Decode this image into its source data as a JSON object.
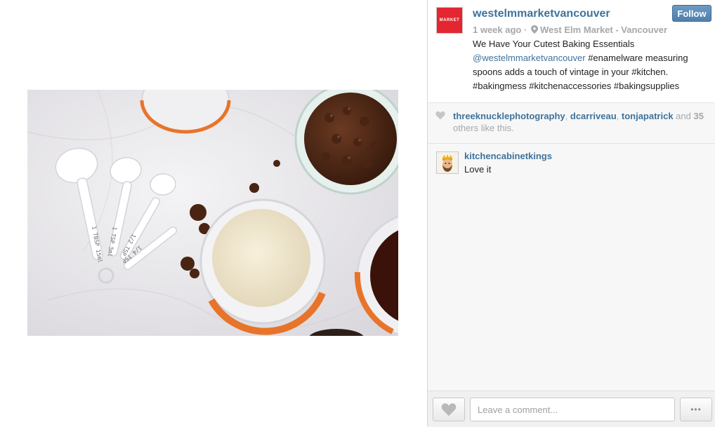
{
  "post": {
    "author": {
      "avatar_text": "MARKET",
      "avatar_color": "#e3262f",
      "username": "westelmmarketvancouver"
    },
    "follow_label": "Follow",
    "time_ago": "1 week ago",
    "separator": " · ",
    "location": "West Elm Market - Vancouver",
    "caption": {
      "line1": "We Have Your Cutest Baking Essentials",
      "mention": "@westelmmarketvancouver",
      "rest": " #enamelware measuring spoons adds a touch of vintage in your #kitchen. #bakingmess #kitchenaccessories #bakingsupplies"
    },
    "image": {
      "icon": "photo-baking-essentials"
    }
  },
  "likes": {
    "users": [
      "threeknucklephotography",
      "dcarriveau",
      "tonjapatrick"
    ],
    "sep1": ", ",
    "sep2": ", ",
    "and_text": " and ",
    "others_count": "35",
    "others_text": " others like this."
  },
  "comments": [
    {
      "username": "kitchencabinetkings",
      "text": "Love it"
    }
  ],
  "composer": {
    "placeholder": "Leave a comment...",
    "more_label": "•••"
  },
  "colors": {
    "link": "#3f729b",
    "muted": "#a5a7aa",
    "follow_bg": "#4f7fad"
  }
}
